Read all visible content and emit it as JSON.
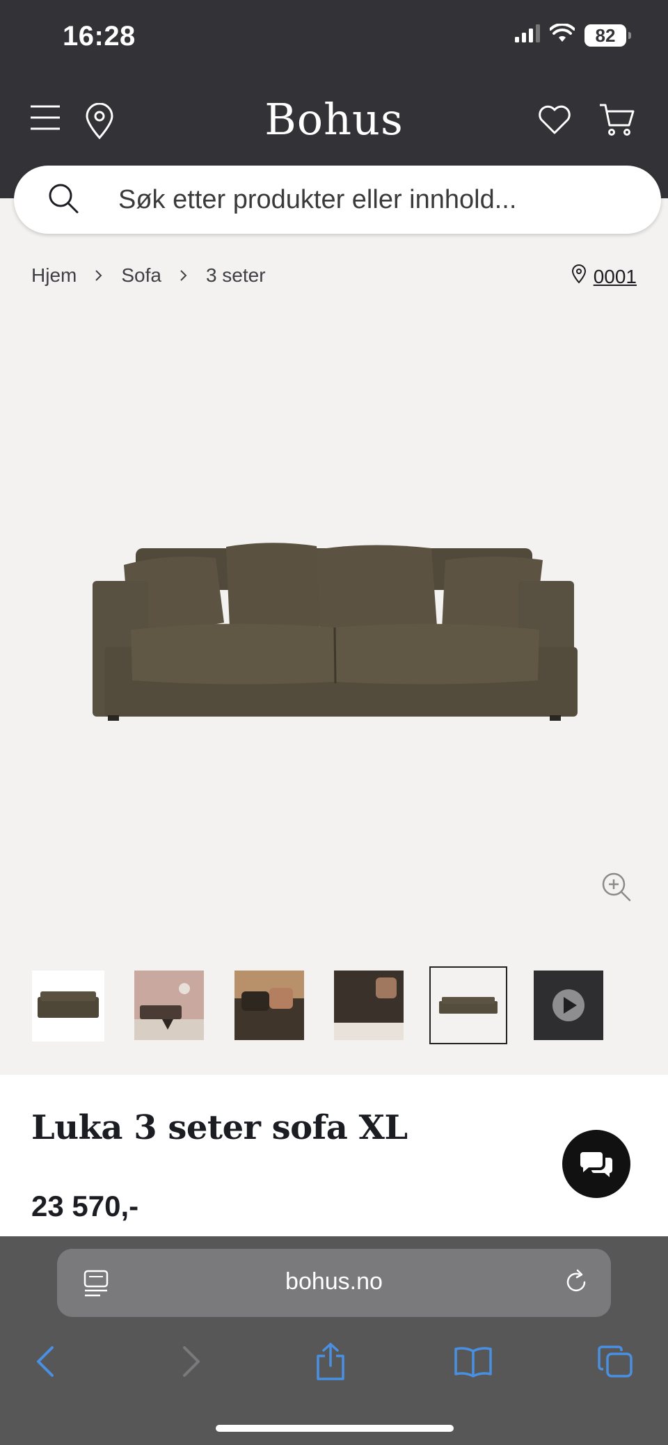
{
  "status_bar": {
    "time": "16:28",
    "battery": "82"
  },
  "header": {
    "logo": "Bohus",
    "menu_icon": "hamburger-icon",
    "location_icon": "map-pin-icon",
    "wishlist_icon": "heart-icon",
    "cart_icon": "cart-icon"
  },
  "search": {
    "placeholder": "Søk etter produkter eller innhold..."
  },
  "breadcrumb": {
    "items": [
      "Hjem",
      "Sofa",
      "3 seter"
    ],
    "store_code": "0001"
  },
  "gallery": {
    "thumbnail_count": 6,
    "selected_index": 4,
    "thumbnails": [
      "sofa-front",
      "living-room",
      "sofa-closeup",
      "sofa-armrest",
      "sofa-front-selected",
      "video"
    ]
  },
  "product": {
    "title": "Luka 3 seter sofa XL",
    "price": "23 570,-"
  },
  "browser": {
    "url": "bohus.no"
  },
  "colors": {
    "header_bg": "#323237",
    "page_bg": "#f4f2f0",
    "sofa": "#5a5140",
    "safari_bar": "#575758",
    "ios_blue": "#4a90e2"
  }
}
